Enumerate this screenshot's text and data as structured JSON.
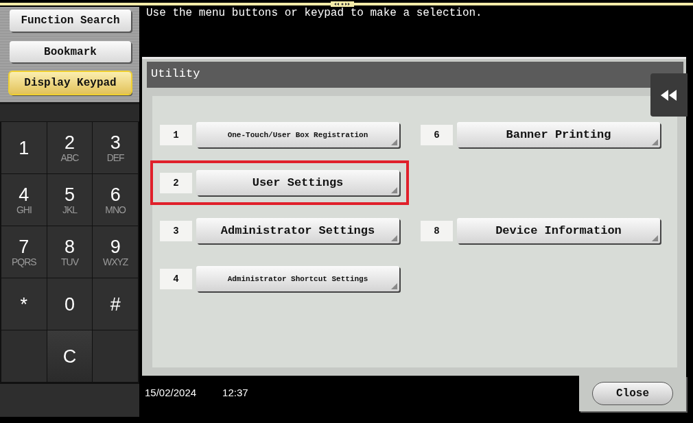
{
  "side_buttons": [
    {
      "label": "Function Search",
      "selected": false
    },
    {
      "label": "Bookmark",
      "selected": false
    },
    {
      "label": "Display Keypad",
      "selected": true
    }
  ],
  "keypad": [
    {
      "kind": "digit",
      "label": "1"
    },
    {
      "kind": "digit",
      "label": "2",
      "letters": "ABC"
    },
    {
      "kind": "digit",
      "label": "3",
      "letters": "DEF"
    },
    {
      "kind": "digit",
      "label": "4",
      "letters": "GHI"
    },
    {
      "kind": "digit",
      "label": "5",
      "letters": "JKL"
    },
    {
      "kind": "digit",
      "label": "6",
      "letters": "MNO"
    },
    {
      "kind": "digit",
      "label": "7",
      "letters": "PQRS"
    },
    {
      "kind": "digit",
      "label": "8",
      "letters": "TUV"
    },
    {
      "kind": "digit",
      "label": "9",
      "letters": "WXYZ"
    },
    {
      "kind": "digit",
      "label": "*"
    },
    {
      "kind": "digit",
      "label": "0"
    },
    {
      "kind": "digit",
      "label": "#"
    },
    {
      "kind": "clear",
      "label": "C"
    }
  ],
  "instruction": "Use the menu buttons or keypad to make a selection.",
  "panel": {
    "title": "Utility",
    "rows": [
      {
        "left": {
          "number": "1",
          "label": "One-Touch/User Box Registration",
          "highlighted": false
        },
        "right": {
          "number": "6",
          "label": "Banner Printing",
          "highlighted": false
        }
      },
      {
        "left": {
          "number": "2",
          "label": "User Settings",
          "highlighted": true
        }
      },
      {
        "left": {
          "number": "3",
          "label": "Administrator Settings",
          "highlighted": false
        },
        "right": {
          "number": "8",
          "label": "Device Information",
          "highlighted": false
        }
      },
      {
        "left": {
          "number": "4",
          "label": "Administrator Shortcut Settings",
          "highlighted": false
        }
      }
    ]
  },
  "status_bar": {
    "date": "15/02/2024",
    "time": "12:37"
  },
  "close_button": "Close"
}
